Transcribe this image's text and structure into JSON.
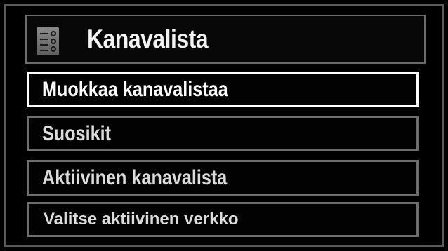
{
  "header": {
    "title": "Kanavalista",
    "icon": "channel-list-icon"
  },
  "menu": {
    "items": [
      {
        "label": "Muokkaa kanavalistaa",
        "selected": true
      },
      {
        "label": "Suosikit",
        "selected": false
      },
      {
        "label": "Aktiivinen kanavalista",
        "selected": false
      },
      {
        "label": "Valitse aktiivinen verkko",
        "selected": false
      }
    ]
  },
  "colors": {
    "background": "#000000",
    "frame": "#5a5a5a",
    "item_border": "#6e6e6e",
    "selected_border": "#ffffff",
    "text": "#e8e8e8"
  }
}
